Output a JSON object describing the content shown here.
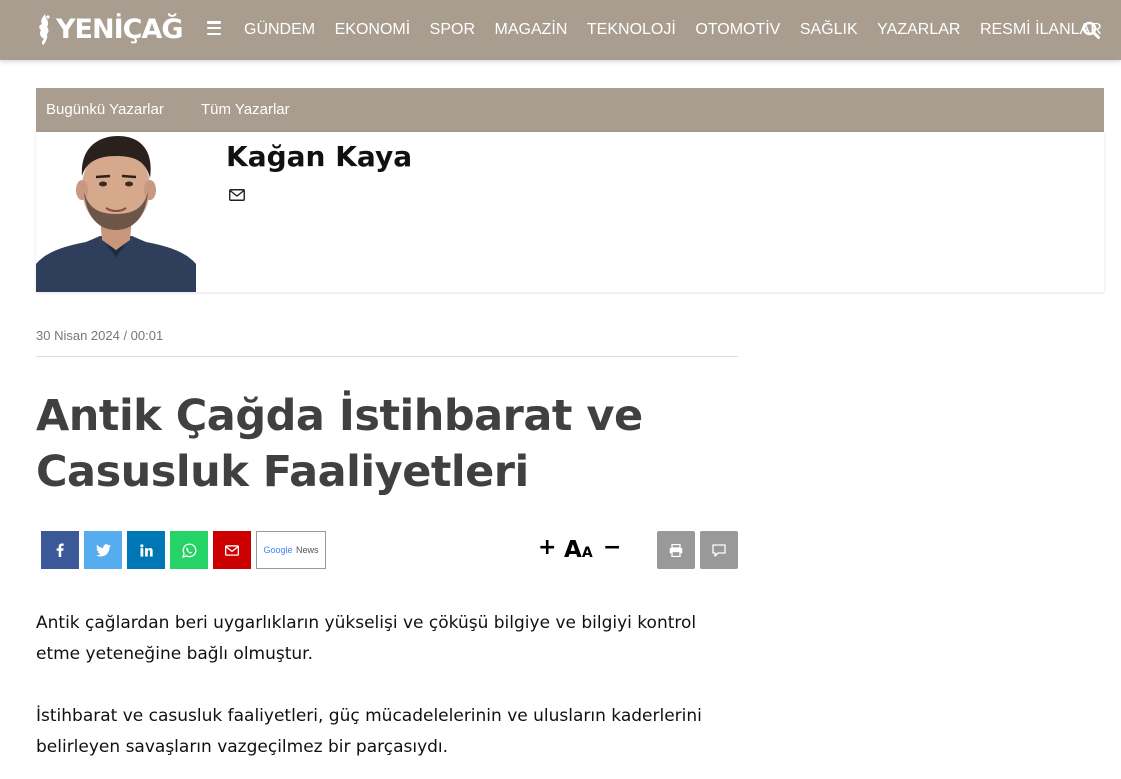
{
  "header": {
    "logo_text": "YENİÇAĞ",
    "nav": [
      "GÜNDEM",
      "EKONOMİ",
      "SPOR",
      "MAGAZİN",
      "TEKNOLOJİ",
      "OTOMOTİV",
      "SAĞLIK",
      "YAZARLAR",
      "RESMİ İLANLAR"
    ]
  },
  "authorbar": {
    "today_label": "Bugünkü Yazarlar",
    "all_label": "Tüm Yazarlar"
  },
  "author": {
    "name": "Kağan Kaya"
  },
  "article": {
    "date": "30 Nisan 2024 / 00:01",
    "title": "Antik Çağda İstihbarat ve Casusluk Faaliyetleri",
    "paragraphs": [
      "Antik çağlardan beri uygarlıkların yükselişi ve çöküşü bilgiye ve bilgiyi kontrol etme yeteneğine bağlı olmuştur.",
      "İstihbarat ve casusluk faaliyetleri, güç mücadelelerinin ve ulusların kaderlerini belirleyen savaşların vazgeçilmez bir parçasıydı."
    ]
  },
  "share": {
    "google_news_prefix": "Google",
    "google_news_suffix": "News",
    "font_plus": "+",
    "font_aa_big": "A",
    "font_aa_small": "A",
    "font_minus": "−"
  },
  "colors": {
    "header_bg": "#a89d8e",
    "facebook": "#3b5998",
    "twitter": "#55acee",
    "linkedin": "#0077b5",
    "whatsapp": "#25d366",
    "email": "#cc0000",
    "tool_gray": "#999999"
  },
  "icons": {
    "menu": "hamburger-icon",
    "search": "search-icon",
    "mail": "envelope-icon",
    "print": "print-icon",
    "comment": "comment-icon"
  }
}
